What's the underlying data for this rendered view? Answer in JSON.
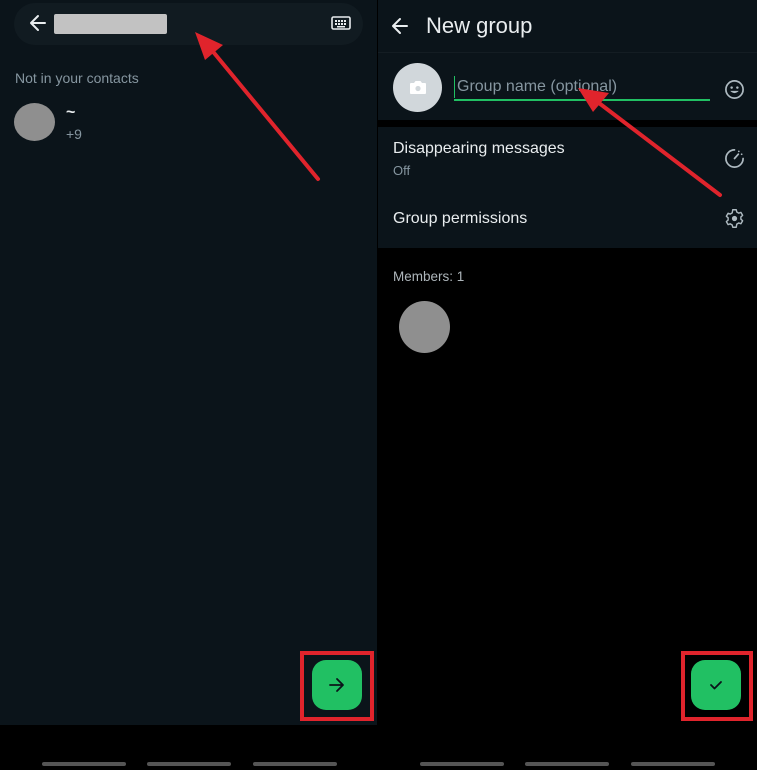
{
  "left_panel": {
    "search": {
      "redacted_query": "",
      "back_icon": "arrow-left-icon",
      "keyboard_icon": "keyboard-icon"
    },
    "section_label": "Not in your contacts",
    "contacts": [
      {
        "name": "~",
        "phone": "+9"
      }
    ],
    "fab": {
      "icon": "arrow-right-icon",
      "label": "→"
    }
  },
  "right_panel": {
    "header": {
      "title": "New group",
      "back_icon": "arrow-left-icon"
    },
    "group_name_input": {
      "value": "",
      "placeholder": "Group name (optional)"
    },
    "settings": [
      {
        "title": "Disappearing messages",
        "subtitle": "Off",
        "icon": "timer-icon"
      },
      {
        "title": "Group permissions",
        "icon": "gear-icon"
      }
    ],
    "members_label": "Members: 1",
    "fab": {
      "icon": "check-icon",
      "label": "✓"
    }
  },
  "colors": {
    "accent_green": "#21c063",
    "panel_bg": "#0b141a",
    "annotation_red": "#e0242c"
  }
}
